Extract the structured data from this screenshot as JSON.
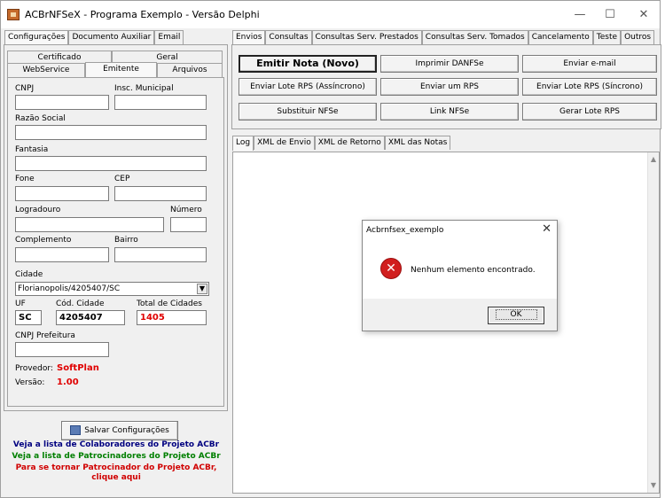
{
  "window": {
    "title": "ACBrNFSeX - Programa Exemplo - Versão Delphi",
    "controls": {
      "minimize": "—",
      "maximize": "☐",
      "close": "✕"
    }
  },
  "left": {
    "tabs": [
      "Configurações",
      "Documento Auxiliar",
      "Email"
    ],
    "subtabs_row1": [
      "Certificado",
      "Geral"
    ],
    "subtabs_row2": [
      "WebService",
      "Emitente",
      "Arquivos"
    ],
    "form": {
      "cnpj_label": "CNPJ",
      "cnpj_value": "",
      "im_label": "Insc. Municipal",
      "im_value": "",
      "razao_label": "Razão Social",
      "razao_value": "",
      "fantasia_label": "Fantasia",
      "fantasia_value": "",
      "fone_label": "Fone",
      "fone_value": "",
      "cep_label": "CEP",
      "cep_value": "",
      "logradouro_label": "Logradouro",
      "logradouro_value": "",
      "numero_label": "Número",
      "numero_value": "",
      "complemento_label": "Complemento",
      "complemento_value": "",
      "bairro_label": "Bairro",
      "bairro_value": "",
      "cidade_label": "Cidade",
      "cidade_value": "Florianopolis/4205407/SC",
      "uf_label": "UF",
      "uf_value": "SC",
      "cod_label": "Cód. Cidade",
      "cod_value": "4205407",
      "total_label": "Total de Cidades",
      "total_value": "1405",
      "cnpj_pref_label": "CNPJ Prefeitura",
      "cnpj_pref_value": "",
      "provedor_label": "Provedor:",
      "provedor_value": "SoftPlan",
      "versao_label": "Versão:",
      "versao_value": "1.00"
    },
    "save_button": "Salvar Configurações",
    "links": [
      "Veja a lista de Colaboradores do Projeto ACBr",
      "Veja a lista de Patrocinadores do Projeto ACBr",
      "Para se tornar Patrocinador do Projeto ACBr,",
      "clique aqui"
    ]
  },
  "right": {
    "tabs": [
      "Envios",
      "Consultas",
      "Consultas Serv. Prestados",
      "Consultas Serv. Tomados",
      "Cancelamento",
      "Teste",
      "Outros"
    ],
    "buttons": [
      [
        "Emitir Nota (Novo)",
        "Imprimir DANFSe",
        "Enviar e-mail"
      ],
      [
        "Enviar Lote RPS (Assíncrono)",
        "Enviar um RPS",
        "Enviar Lote RPS (Síncrono)"
      ],
      [
        "Substituir NFSe",
        "Link NFSe",
        "Gerar Lote RPS"
      ]
    ],
    "log_tabs": [
      "Log",
      "XML de Envio",
      "XML de Retorno",
      "XML das Notas"
    ]
  },
  "dialog": {
    "title": "Acbrnfsex_exemplo",
    "message": "Nenhum elemento encontrado.",
    "ok": "OK"
  },
  "colors": {
    "red_value": "#e00000",
    "link_blue": "#000080",
    "link_green": "#007f00",
    "link_red": "#d00000"
  }
}
